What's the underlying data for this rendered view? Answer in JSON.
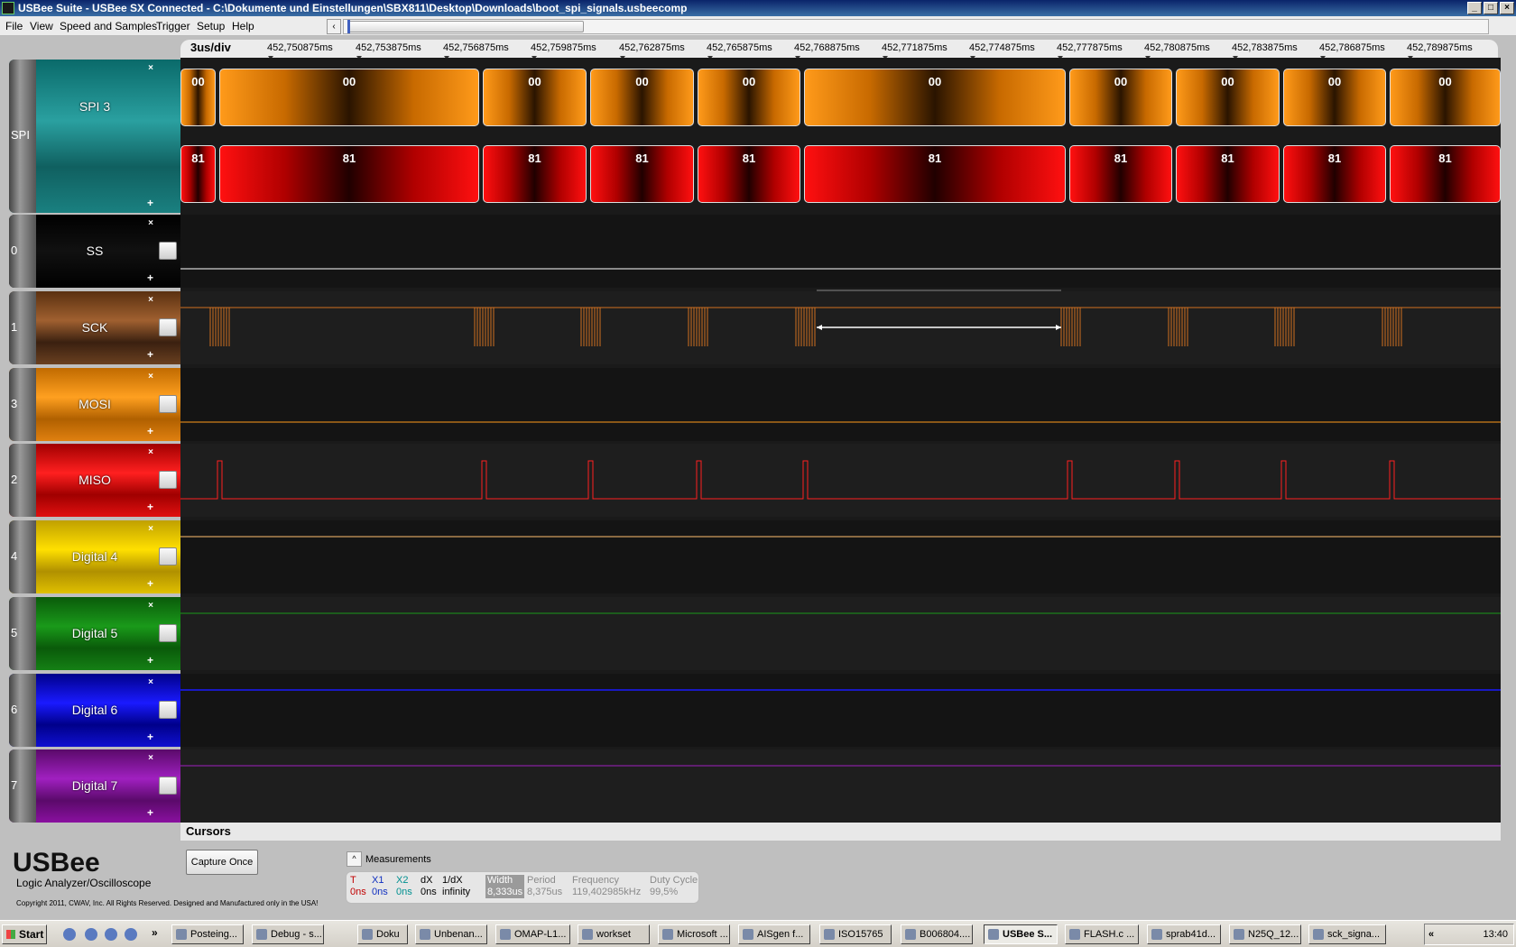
{
  "window": {
    "title": "USBee Suite - USBee SX Connected - C:\\Dokumente und Einstellungen\\SBX811\\Desktop\\Downloads\\boot_spi_signals.usbeecomp"
  },
  "menu": [
    "File",
    "View",
    "Speed and Samples",
    "Trigger",
    "Setup",
    "Help"
  ],
  "timebase": {
    "div_label": "3us/div",
    "ticks": [
      "452,750875ms",
      "452,753875ms",
      "452,756875ms",
      "452,759875ms",
      "452,762875ms",
      "452,765875ms",
      "452,768875ms",
      "452,771875ms",
      "452,774875ms",
      "452,777875ms",
      "452,780875ms",
      "452,783875ms",
      "452,786875ms",
      "452,789875ms"
    ]
  },
  "bus": {
    "group_label": "SPI",
    "name": "SPI 3",
    "mosi_bytes": [
      "00",
      "00",
      "00",
      "00",
      "00",
      "00",
      "00",
      "00",
      "00",
      "00"
    ],
    "miso_bytes": [
      "81",
      "81",
      "81",
      "81",
      "81",
      "81",
      "81",
      "81",
      "81",
      "81"
    ]
  },
  "channels": [
    {
      "num": "0",
      "name": "SS",
      "color": "#ffffff"
    },
    {
      "num": "1",
      "name": "SCK",
      "color": "#d07020"
    },
    {
      "num": "3",
      "name": "MOSI",
      "color": "#ff9a1a"
    },
    {
      "num": "2",
      "name": "MISO",
      "color": "#ff2020"
    },
    {
      "num": "4",
      "name": "Digital 4",
      "color": "#ffe000"
    },
    {
      "num": "5",
      "name": "Digital 5",
      "color": "#1a9a1a"
    },
    {
      "num": "6",
      "name": "Digital 6",
      "color": "#1a1aff"
    },
    {
      "num": "7",
      "name": "Digital 7",
      "color": "#a020c0"
    }
  ],
  "controls": {
    "close_glyph": "×",
    "add_glyph": "+",
    "scroll_left": "‹"
  },
  "cursors": {
    "label": "Cursors"
  },
  "capture": {
    "label": "Capture Once"
  },
  "measurements": {
    "title": "Measurements",
    "toggle": "^",
    "cols": [
      {
        "head": "T",
        "value": "0ns",
        "color": "#c00000"
      },
      {
        "head": "X1",
        "value": "0ns",
        "color": "#1030c0"
      },
      {
        "head": "X2",
        "value": "0ns",
        "color": "#009090"
      },
      {
        "head": "dX",
        "value": "0ns",
        "color": "#000000"
      },
      {
        "head": "1/dX",
        "value": "infinity",
        "color": "#000000"
      },
      {
        "head": "Width",
        "value": "8,333us",
        "color": "#ffffff"
      },
      {
        "head": "Period",
        "value": "8,375us",
        "color": "#8a8a8a"
      },
      {
        "head": "Frequency",
        "value": "119,402985kHz",
        "color": "#8a8a8a"
      },
      {
        "head": "Duty Cycle",
        "value": "99,5%",
        "color": "#8a8a8a"
      }
    ]
  },
  "branding": {
    "logo": "USBee",
    "subtitle": "Logic Analyzer/Oscilloscope",
    "copyright": "Copyright 2011, CWAV, Inc. All Rights Reserved. Designed and Manufactured only in the USA!"
  },
  "taskbar": {
    "start": "Start",
    "more": "»",
    "tasks": [
      "Posteing...",
      "Debug - s...",
      "Doku",
      "Unbenan...",
      "OMAP-L1...",
      "workset",
      "Microsoft ...",
      "AISgen f...",
      "ISO15765",
      "B006804....",
      "USBee S...",
      "FLASH.c ...",
      "sprab41d...",
      "N25Q_12...",
      "sck_signa..."
    ],
    "active_index": 10,
    "clock": "13:40",
    "tray_more": "«"
  }
}
